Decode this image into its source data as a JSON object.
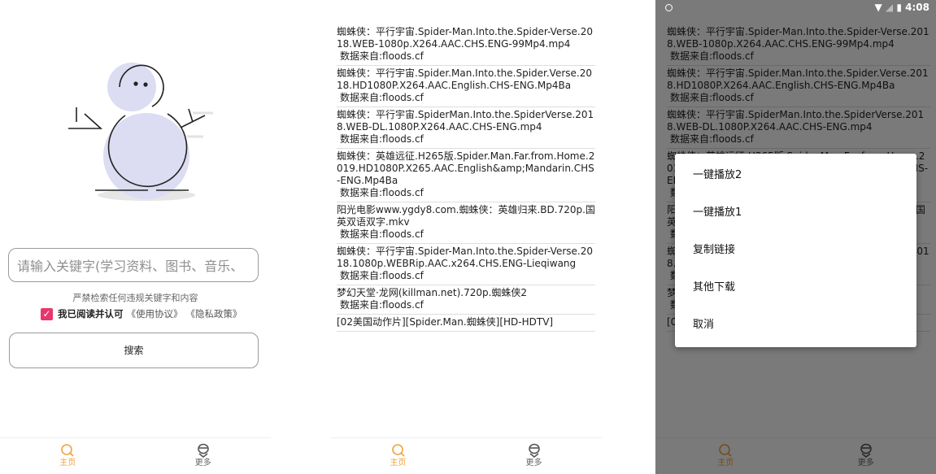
{
  "search_screen": {
    "search_placeholder": "请输入关键字(学习资料、图书、音乐、",
    "warning": "严禁检索任何违规关键字和内容",
    "agree_label": "我已阅读并认可",
    "terms_link": "《使用协议》",
    "privacy_link": "《隐私政策》",
    "search_button": "搜索"
  },
  "results": [
    {
      "title": "蜘蛛侠：平行宇宙.Spider-Man.Into.the.Spider-Verse.2018.WEB-1080p.X264.AAC.CHS.ENG-99Mp4.mp4",
      "source": "数据来自:floods.cf"
    },
    {
      "title": "蜘蛛侠：平行宇宙.Spider.Man.Into.the.Spider.Verse.2018.HD1080P.X264.AAC.English.CHS-ENG.Mp4Ba",
      "source": "数据来自:floods.cf"
    },
    {
      "title": "蜘蛛侠：平行宇宙.SpiderMan.Into.the.SpiderVerse.2018.WEB-DL.1080P.X264.AAC.CHS-ENG.mp4",
      "source": "数据来自:floods.cf"
    },
    {
      "title": "蜘蛛侠：英雄远征.H265版.Spider.Man.Far.from.Home.2019.HD1080P.X265.AAC.English&amp;Mandarin.CHS-ENG.Mp4Ba",
      "source": "数据来自:floods.cf"
    },
    {
      "title": "阳光电影www.ygdy8.com.蜘蛛侠：英雄归来.BD.720p.国英双语双字.mkv",
      "source": "数据来自:floods.cf"
    },
    {
      "title": "蜘蛛侠：平行宇宙.Spider-Man.Into.the.Spider-Verse.2018.1080p.WEBRip.AAC.x264.CHS.ENG-Lieqiwang",
      "source": "数据来自:floods.cf"
    },
    {
      "title": "梦幻天堂·龙网(killman.net).720p.蜘蛛侠2",
      "source": "数据来自:floods.cf"
    },
    {
      "title": "[02美国动作片][Spider.Man.蜘蛛侠][HD-HDTV]",
      "source": ""
    }
  ],
  "nav": {
    "home_label": "主页",
    "more_label": "更多"
  },
  "status_bar": {
    "time": "4:08"
  },
  "dialog": {
    "items": [
      "一键播放2",
      "一键播放1",
      "复制链接",
      "其他下载",
      "取消"
    ]
  }
}
